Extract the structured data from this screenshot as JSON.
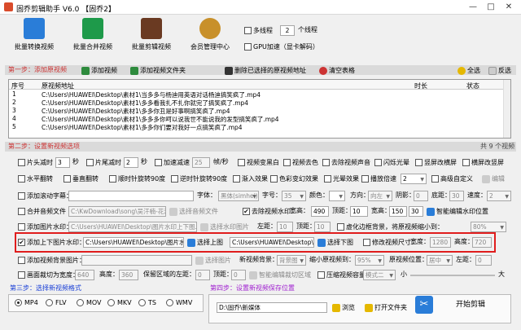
{
  "titlebar": {
    "title": "固乔剪辑助手 V6.0 【固乔2】",
    "min": "—",
    "max": "□",
    "close": "✕"
  },
  "toolbar": {
    "items": [
      {
        "label": "批量转换视频",
        "color": "#2a7dd8"
      },
      {
        "label": "批量合并视频",
        "color": "#1e9a4a"
      },
      {
        "label": "批量剪辑视频",
        "color": "#6a3a22"
      },
      {
        "label": "会员管理中心",
        "color": "#c8902a"
      }
    ],
    "multithread_label": "多线程",
    "thread_count": "2",
    "thread_unit": "个线程",
    "gpu_label": "GPU加速（显卡解码）"
  },
  "step1": {
    "title": "第一步：添加原视频",
    "add_video": "添加视频",
    "add_folder": "添加视频文件夹",
    "delete_selected": "删除已选择的原视频地址",
    "clear_table": "清空表格",
    "select_all": "全选",
    "invert": "反选"
  },
  "table": {
    "columns": [
      "序号",
      "原视频地址",
      "时长",
      "状态"
    ],
    "rows": [
      {
        "index": "1",
        "path": "C:\\Users\\HUAWEI\\Desktop\\素材1\\当多多与杨迪用英语对话杨迪搞笑疯了.mp4",
        "duration": "",
        "status": ""
      },
      {
        "index": "2",
        "path": "C:\\Users\\HUAWEI\\Desktop\\素材1\\多多看我扎不扎你就完了搞笑疯了.mp4",
        "duration": "",
        "status": ""
      },
      {
        "index": "3",
        "path": "C:\\Users\\HUAWEI\\Desktop\\素材1\\多多你丑是好事啊搞笑疯了.mp4",
        "duration": "",
        "status": ""
      },
      {
        "index": "4",
        "path": "C:\\Users\\HUAWEI\\Desktop\\素材1\\多多多你呵以说我世不能说我的发型搞笑疯了.mp4",
        "duration": "",
        "status": ""
      },
      {
        "index": "5",
        "path": "C:\\Users\\HUAWEI\\Desktop\\素材1\\多多你们要对我好一点搞笑疯了.mp4",
        "duration": "",
        "status": ""
      }
    ],
    "count": "共 9 个视频"
  },
  "step2": {
    "title": "第二步：设置新视频选项",
    "row1": {
      "head_cut": "片头减时",
      "head_val": "3",
      "sec1": "秒",
      "tail_cut": "片尾减时",
      "tail_val": "2",
      "sec2": "秒",
      "speed_change": "加速减速",
      "speed_val": "25",
      "speed_unit": "帧/秒",
      "black_white": "视频变黑白",
      "color_remove": "视频去色",
      "remove_sound": "去除视频声音",
      "flash": "闪烁光晕",
      "vertical_blur": "竖屏改横屏",
      "horizontal_blur": "横屏改竖屏"
    },
    "row2": {
      "hflip": "水平翻转",
      "vflip": "垂直翻转",
      "rot90": "顺时针旋转90度",
      "rot_ccw": "逆时针旋转90度",
      "fade_in": "渐入效果",
      "color_diff": "色彩变幻效果",
      "light": "光晕效果",
      "playback": "播放倍速",
      "playback_val": "2",
      "custom": "高级自定义",
      "edit": "编辑"
    },
    "row3": {
      "subtitle": "添加滚动字幕：",
      "font": "字体：",
      "font_val": "黑体(simhei)",
      "size": "字号：",
      "size_val": "35",
      "color": "颜色：",
      "direction": "方向：",
      "direction_val": "向左",
      "shadow": "阴影：",
      "shadow_val": "0",
      "bottom": "底距：",
      "bottom_val": "30",
      "speed": "速度：",
      "speed_val": "2"
    },
    "row4": {
      "merge_audio": "合并音频文件",
      "audio_path": "C:\\KwDownload\\song\\吴汗楠-花泽香菜-",
      "choose_audio": "选择音频文件",
      "remove_watermark": "去除视频水印：",
      "remove_w_label": "宽高：",
      "rw_w": "490",
      "top_dist": "顶距：",
      "top_val": "10",
      "wh": "宽高：",
      "w_val": "150",
      "h_val": "30",
      "smart_edit": "智能编辑水印位置"
    },
    "row5": {
      "image_watermark": "添加图片水印：",
      "image_path": "C:\\Users\\HUAWEI\\Desktop\\图片水印上下图.jpg",
      "choose_watermark": "选择水印图片",
      "left": "左距：",
      "left_val": "10",
      "top": "顶距：",
      "top_val": "10",
      "virtual_bg": "虚化边框背景，将原视频缩小到：",
      "virtual_val": "80%"
    },
    "row6": {
      "add_top_bottom": "添加上下图片水印：",
      "top_path": "C:\\Users\\HUAWEI\\Desktop\\图片水印",
      "choose_top": "选择上图",
      "bottom_path": "C:\\Users\\HUAWEI\\Desktop\\图片",
      "choose_bottom": "选择下图",
      "modify_size": "修改视频尺寸：",
      "width_label": "宽度：",
      "width_val": "1280",
      "height_label": "高度：",
      "height_val": "720"
    },
    "row7": {
      "add_bg": "添加视频背景图片：",
      "choose_bg": "选择图片",
      "new_bg": "新视频背景：",
      "new_bg_val": "背景图",
      "shrink": "缩小原视频到：",
      "shrink_val": "95%",
      "position": "原视频位置：",
      "position_val": "居中",
      "left": "左距：",
      "left_val": "0"
    },
    "row8": {
      "crop": "画面裁切为宽度：",
      "crop_w": "640",
      "height": "高度：",
      "crop_h": "360",
      "keep_left": "保留区域的左距：",
      "keep_left_val": "0",
      "top": "顶距：",
      "top_val": "0",
      "smart_crop": "智能编辑裁切区域",
      "compress": "压缩视频容量",
      "compress_mode": "模式二",
      "size_small": "小",
      "size_big": "大"
    }
  },
  "step3": {
    "title": "第三步：选择新视频格式",
    "formats": [
      "MP4",
      "FLV",
      "MOV",
      "MKV",
      "TS",
      "WMV"
    ],
    "selected": "MP4"
  },
  "step4": {
    "title": "第四步：设置新视频保存位置",
    "path": "D:\\固乔\\新媒体",
    "browse": "浏览",
    "open_folder": "打开文件夹",
    "start": "开始剪辑"
  }
}
